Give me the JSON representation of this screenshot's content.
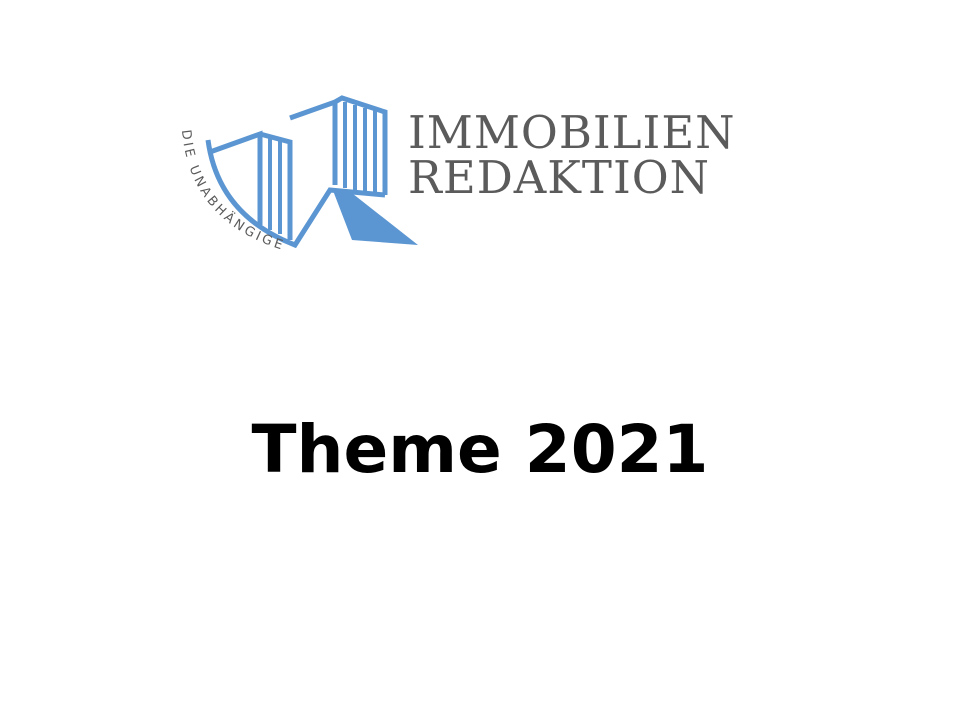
{
  "logo": {
    "name_line_1": "IMMOBILIEN",
    "name_line_2": "REDAKTION",
    "tagline": "DIE UNABHÄNGIGE",
    "icon": "buildings-logo-icon",
    "brand_color": "#5b96d2",
    "text_color": "#5b5b5b"
  },
  "headline": "Theme 2021"
}
